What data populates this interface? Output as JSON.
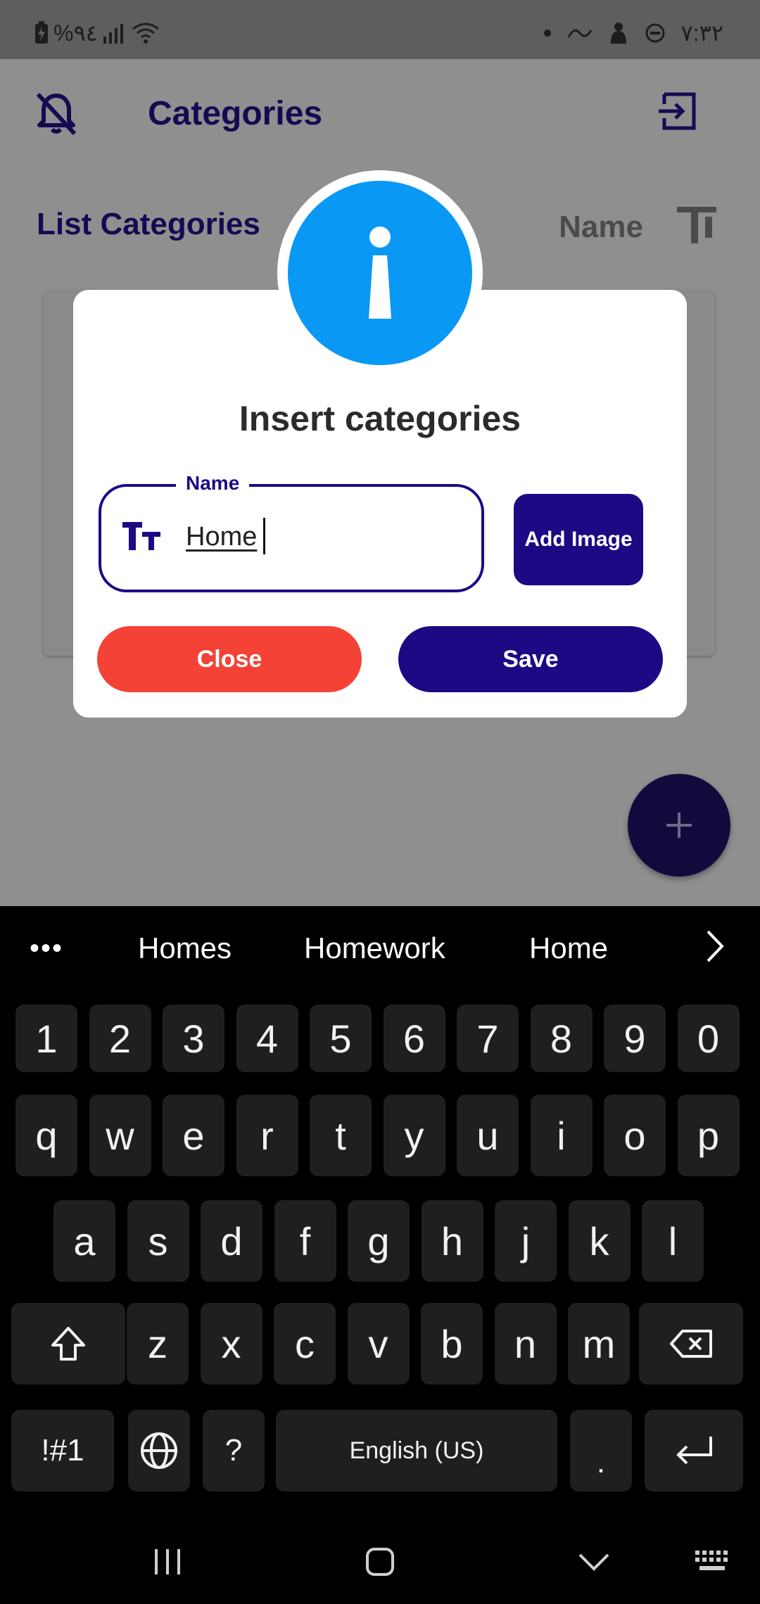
{
  "status_bar": {
    "battery": "%٩٤",
    "time": "٧:٣٢"
  },
  "app": {
    "title": "Categories",
    "list_title": "List Categories",
    "sort_label": "Name",
    "icons": [
      "bell-off-icon",
      "logout-icon",
      "sort-text-icon",
      "plus-icon"
    ]
  },
  "dialog": {
    "title": "Insert categories",
    "field_label": "Name",
    "field_value": "Home",
    "add_image_label": "Add Image",
    "close_label": "Close",
    "save_label": "Save",
    "colors": {
      "primary": "#1c0a85",
      "danger": "#f44336",
      "info": "#0a98f5"
    }
  },
  "keyboard": {
    "more": "•••",
    "suggestions": [
      "Homes",
      "Homework",
      "Home"
    ],
    "rows": {
      "numbers": [
        "1",
        "2",
        "3",
        "4",
        "5",
        "6",
        "7",
        "8",
        "9",
        "0"
      ],
      "row1": [
        "q",
        "w",
        "e",
        "r",
        "t",
        "y",
        "u",
        "i",
        "o",
        "p"
      ],
      "row2": [
        "a",
        "s",
        "d",
        "f",
        "g",
        "h",
        "j",
        "k",
        "l"
      ],
      "row3": [
        "z",
        "x",
        "c",
        "v",
        "b",
        "n",
        "m"
      ]
    },
    "symbols_key": "!#1",
    "question_key": "?",
    "space_label": "English (US)",
    "period_key": "."
  }
}
